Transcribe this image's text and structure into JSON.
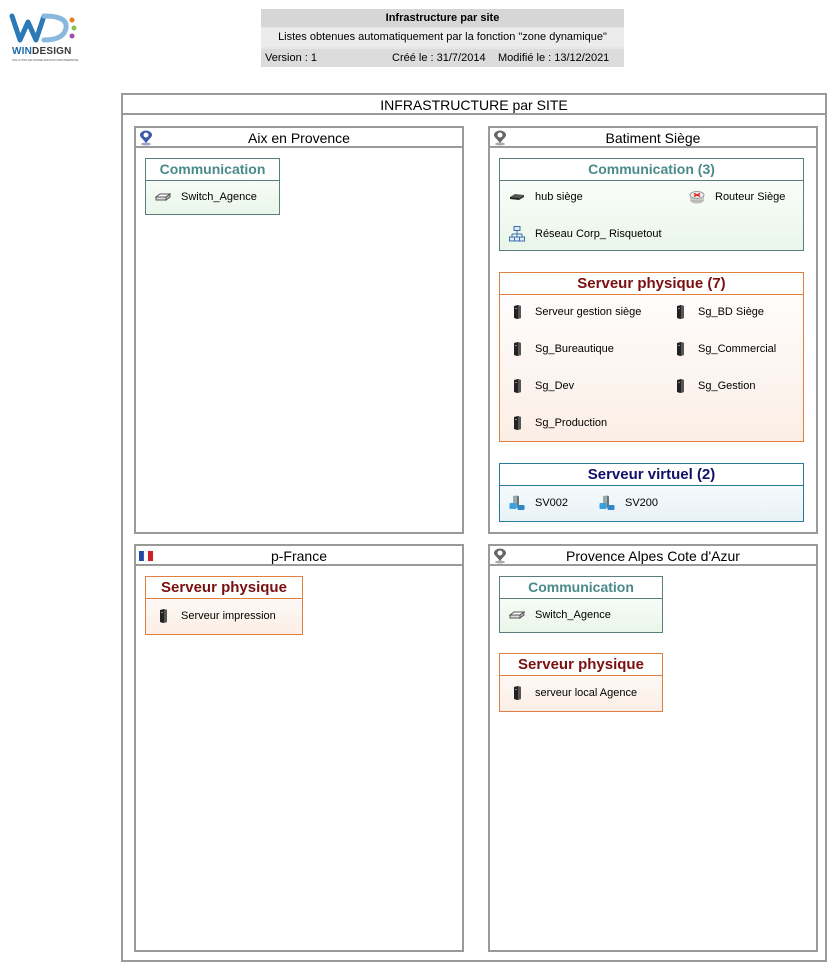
{
  "logo": {
    "brand_a": "WIN",
    "brand_b": "DESIGN",
    "tagline": "SOLUTION DE MODELISATION D'ENTREPRISE"
  },
  "header": {
    "title": "Infrastructure par site",
    "subtitle": "Listes obtenues automatiquement par la fonction \"zone dynamique\"",
    "version": "Version : 1",
    "created": "Créé le : 31/7/2014",
    "modified": "Modifié le : 13/12/2021"
  },
  "main": {
    "title": "INFRASTRUCTURE par SITE"
  },
  "sites": [
    {
      "name": "Aix en Provence",
      "icon": "location-pin-icon",
      "groups": [
        {
          "title": "Communication",
          "kind": "comm",
          "items": [
            {
              "label": "Switch_Agence",
              "icon": "switch-icon"
            }
          ]
        }
      ]
    },
    {
      "name": "Batiment Siège",
      "icon": "location-pin-icon",
      "groups": [
        {
          "title": "Communication (3)",
          "kind": "comm",
          "items": [
            {
              "label": "hub siège",
              "icon": "hub-icon"
            },
            {
              "label": "Routeur Siège",
              "icon": "router-icon"
            },
            {
              "label": "Réseau Corp_ Risquetout",
              "icon": "network-icon"
            }
          ]
        },
        {
          "title": "Serveur physique (7)",
          "kind": "phys",
          "items": [
            {
              "label": "Serveur gestion siège",
              "icon": "server-icon"
            },
            {
              "label": "Sg_BD Siège",
              "icon": "server-icon"
            },
            {
              "label": "Sg_Bureautique",
              "icon": "server-icon"
            },
            {
              "label": "Sg_Commercial",
              "icon": "server-icon"
            },
            {
              "label": "Sg_Dev",
              "icon": "server-icon"
            },
            {
              "label": "Sg_Gestion",
              "icon": "server-icon"
            },
            {
              "label": "Sg_Production",
              "icon": "server-icon"
            }
          ]
        },
        {
          "title": "Serveur virtuel (2)",
          "kind": "virt",
          "items": [
            {
              "label": "SV002",
              "icon": "virtual-server-icon"
            },
            {
              "label": "SV200",
              "icon": "virtual-server-icon"
            }
          ]
        }
      ]
    },
    {
      "name": "p-France",
      "icon": "france-flag-icon",
      "groups": [
        {
          "title": "Serveur physique",
          "kind": "phys",
          "items": [
            {
              "label": "Serveur impression",
              "icon": "server-icon"
            }
          ]
        }
      ]
    },
    {
      "name": "Provence Alpes Cote d'Azur",
      "icon": "location-pin-icon",
      "groups": [
        {
          "title": "Communication",
          "kind": "comm",
          "items": [
            {
              "label": "Switch_Agence",
              "icon": "switch-icon"
            }
          ]
        },
        {
          "title": "Serveur physique",
          "kind": "phys",
          "items": [
            {
              "label": "serveur local  Agence",
              "icon": "server-icon"
            }
          ]
        }
      ]
    }
  ]
}
